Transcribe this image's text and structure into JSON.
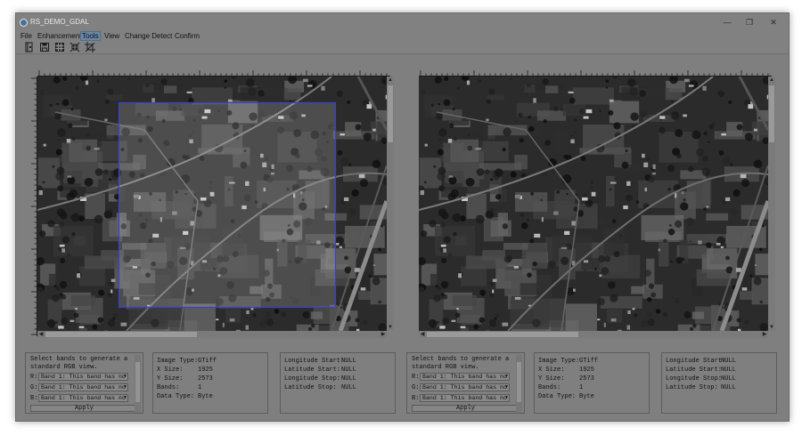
{
  "window": {
    "title": "RS_DEMO_GDAL",
    "controls": [
      "—",
      "❐",
      "✕"
    ]
  },
  "menu": [
    {
      "label": "File",
      "active": false
    },
    {
      "label": "Enhancement",
      "active": false
    },
    {
      "label": "Tools",
      "active": true
    },
    {
      "label": "View",
      "active": false
    },
    {
      "label": "Change Detect",
      "active": false
    },
    {
      "label": "Confirm",
      "active": false
    }
  ],
  "toolbar": [
    "open-file-icon",
    "save-icon",
    "grid-icon",
    "shrink-icon",
    "crop-icon"
  ],
  "left_panel": {
    "band_description": "Select bands to generate a standard RGB view.",
    "bands": [
      {
        "label": "R:",
        "value": "Band 1: This band has no"
      },
      {
        "label": "G:",
        "value": "Band 1: This band has no"
      },
      {
        "label": "B:",
        "value": "Band 1: This band has no"
      }
    ],
    "apply_label": "Apply",
    "info": {
      "image_type_label": "Image Type:",
      "image_type": "GTiff",
      "x_size_label": "X Size:",
      "x_size": "1925",
      "y_size_label": "Y Size:",
      "y_size": "2573",
      "bands_label": "Bands:",
      "bands": "1",
      "data_type_label": "Data Type:",
      "data_type": "Byte"
    },
    "geo": {
      "lon_start_label": "Longitude Start:",
      "lon_start": "NULL",
      "lat_start_label": "Latitude Start:",
      "lat_start": "NULL",
      "lon_stop_label": "Longitude Stop:",
      "lon_stop": "NULL",
      "lat_stop_label": "Latitude Stop:",
      "lat_stop": "NULL"
    }
  },
  "right_panel": {
    "band_description": "Select bands to generate a standard RGB view.",
    "bands": [
      {
        "label": "R:",
        "value": "Band 1: This band has no"
      },
      {
        "label": "G:",
        "value": "Band 1: This band has no"
      },
      {
        "label": "B:",
        "value": "Band 1: This band has no"
      }
    ],
    "apply_label": "Apply",
    "info": {
      "image_type_label": "Image Type:",
      "image_type": "GTiff",
      "x_size_label": "X Size:",
      "x_size": "1925",
      "y_size_label": "Y Size:",
      "y_size": "2573",
      "bands_label": "Bands:",
      "bands": "1",
      "data_type_label": "Data Type:",
      "data_type": "Byte"
    },
    "geo": {
      "lon_start_label": "Longitude Start:",
      "lon_start": "NULL",
      "lat_start_label": "Latitude Start:",
      "lat_start": "NULL",
      "lon_stop_label": "Longitude Stop:",
      "lon_stop": "NULL",
      "lat_stop_label": "Latitude Stop:",
      "lat_stop": "NULL"
    }
  },
  "colors": {
    "window_bg": "#7f7f7f",
    "menu_active": "#6a87a5",
    "selection": "#3344cc"
  }
}
